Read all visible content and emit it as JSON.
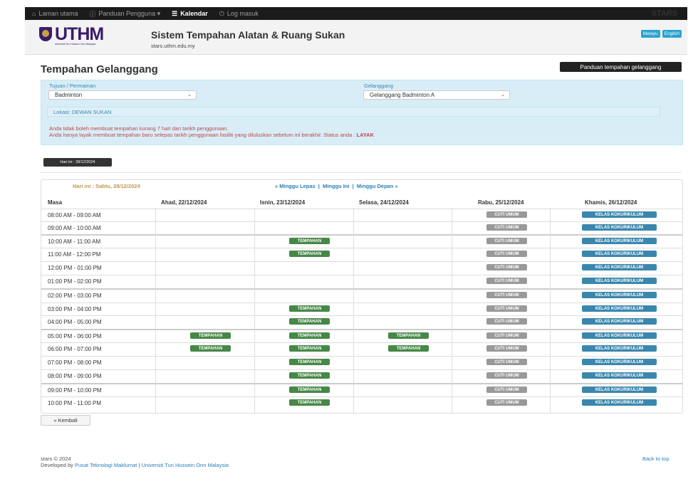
{
  "topnav": {
    "items": [
      {
        "icon": "home-icon",
        "label": "Laman utama"
      },
      {
        "icon": "info-circle-icon",
        "label": "Panduan Pengguna ▾"
      },
      {
        "icon": "list-icon",
        "label": "Kalendar"
      },
      {
        "icon": "power-icon",
        "label": "Log masuk"
      }
    ],
    "brand": "STARS"
  },
  "header": {
    "logo_text": "UTHM",
    "logo_sub": "Universiti Tun Hussein Onn Malaysia",
    "title": "Sistem Tempahan Alatan & Ruang Sukan",
    "url": "stars.uthm.edu.my",
    "lang": [
      "Melayu",
      "English"
    ]
  },
  "page": {
    "title": "Tempahan Gelanggang",
    "guide_button": "Panduan tempahan gelanggang"
  },
  "form": {
    "purpose_label": "Tujuan / Permainan",
    "purpose_value": "Badminton",
    "court_label": "Gelanggang",
    "court_value": "Gelanggang Badminton A",
    "location": "Lokasi: DEWAN SUKAN",
    "warning1": "Anda tidak boleh membuat tempahan kurang 7 hari dari tarikh penggunaan.",
    "warning2": "Anda hanya layak membuat tempahan baru selepas tarikh penggunaan fasiliti yang diluluskan sebelum ini berakhir. Status anda : ",
    "status": "LAYAK"
  },
  "date_badge": "Hari ini : 28/12/2024",
  "schedule": {
    "today": "Hari ini : Sabtu, 28/12/2024",
    "nav_prev": "« Minggu Lepas",
    "nav_current": "Minggu Ini",
    "nav_next": "Minggu Depan »",
    "nav_sep": "|",
    "headers": [
      "Masa",
      "Ahad, 22/12/2024",
      "Isnin, 23/12/2024",
      "Selasa, 24/12/2024",
      "Rabu, 25/12/2024",
      "Khamis, 26/12/2024"
    ],
    "rows": [
      {
        "time": "08:00 AM - 09:00 AM",
        "cells": [
          "",
          "",
          "",
          "CUTI UMUM",
          "KELAS KOKURIKULUM"
        ]
      },
      {
        "time": "09:00 AM - 10:00 AM",
        "cells": [
          "",
          "",
          "",
          "CUTI UMUM",
          "KELAS KOKURIKULUM"
        ]
      },
      {
        "time": "10:00 AM - 11:00 AM",
        "cells": [
          "",
          "TEMPAHAN",
          "",
          "CUTI UMUM",
          "KELAS KOKURIKULUM"
        ]
      },
      {
        "time": "11:00 AM - 12:00 PM",
        "cells": [
          "",
          "TEMPAHAN",
          "",
          "CUTI UMUM",
          "KELAS KOKURIKULUM"
        ]
      },
      {
        "time": "12:00 PM - 01:00 PM",
        "cells": [
          "",
          "",
          "",
          "CUTI UMUM",
          "KELAS KOKURIKULUM"
        ]
      },
      {
        "time": "01:00 PM - 02:00 PM",
        "cells": [
          "",
          "",
          "",
          "CUTI UMUM",
          "KELAS KOKURIKULUM"
        ]
      },
      {
        "time": "02:00 PM - 03:00 PM",
        "cells": [
          "",
          "",
          "",
          "CUTI UMUM",
          "KELAS KOKURIKULUM"
        ]
      },
      {
        "time": "03:00 PM - 04:00 PM",
        "cells": [
          "",
          "TEMPAHAN",
          "",
          "CUTI UMUM",
          "KELAS KOKURIKULUM"
        ]
      },
      {
        "time": "04:00 PM - 05:00 PM",
        "cells": [
          "",
          "TEMPAHAN",
          "",
          "CUTI UMUM",
          "KELAS KOKURIKULUM"
        ]
      },
      {
        "time": "05:00 PM - 06:00 PM",
        "cells": [
          "TEMPAHAN",
          "TEMPAHAN",
          "TEMPAHAN",
          "CUTI UMUM",
          "KELAS KOKURIKULUM"
        ]
      },
      {
        "time": "06:00 PM - 07:00 PM",
        "cells": [
          "TEMPAHAN",
          "TEMPAHAN",
          "TEMPAHAN",
          "CUTI UMUM",
          "KELAS KOKURIKULUM"
        ]
      },
      {
        "time": "07:00 PM - 08:00 PM",
        "cells": [
          "",
          "TEMPAHAN",
          "",
          "CUTI UMUM",
          "KELAS KOKURIKULUM"
        ]
      },
      {
        "time": "08:00 PM - 09:00 PM",
        "cells": [
          "",
          "TEMPAHAN",
          "",
          "CUTI UMUM",
          "KELAS KOKURIKULUM"
        ]
      },
      {
        "time": "09:00 PM - 10:00 PM",
        "cells": [
          "",
          "TEMPAHAN",
          "",
          "CUTI UMUM",
          "KELAS KOKURIKULUM"
        ]
      },
      {
        "time": "10:00 PM - 11:00 PM",
        "cells": [
          "",
          "TEMPAHAN",
          "",
          "CUTI UMUM",
          "KELAS KOKURIKULUM"
        ]
      }
    ]
  },
  "back_button": "« Kembali",
  "footer": {
    "copyright": "stars © 2024",
    "developed_prefix": "Developed by ",
    "dev_link1": "Pusat Teknologi Maklumat",
    "dev_sep": " | ",
    "dev_link2": "Universiti Tun Hussein Onn Malaysia",
    "back_to_top": "Back to top"
  },
  "colors": {
    "booking": "#468847",
    "holiday": "#999999",
    "class": "#3a87ad",
    "link": "#2a80b9",
    "warning": "#b94a48"
  }
}
